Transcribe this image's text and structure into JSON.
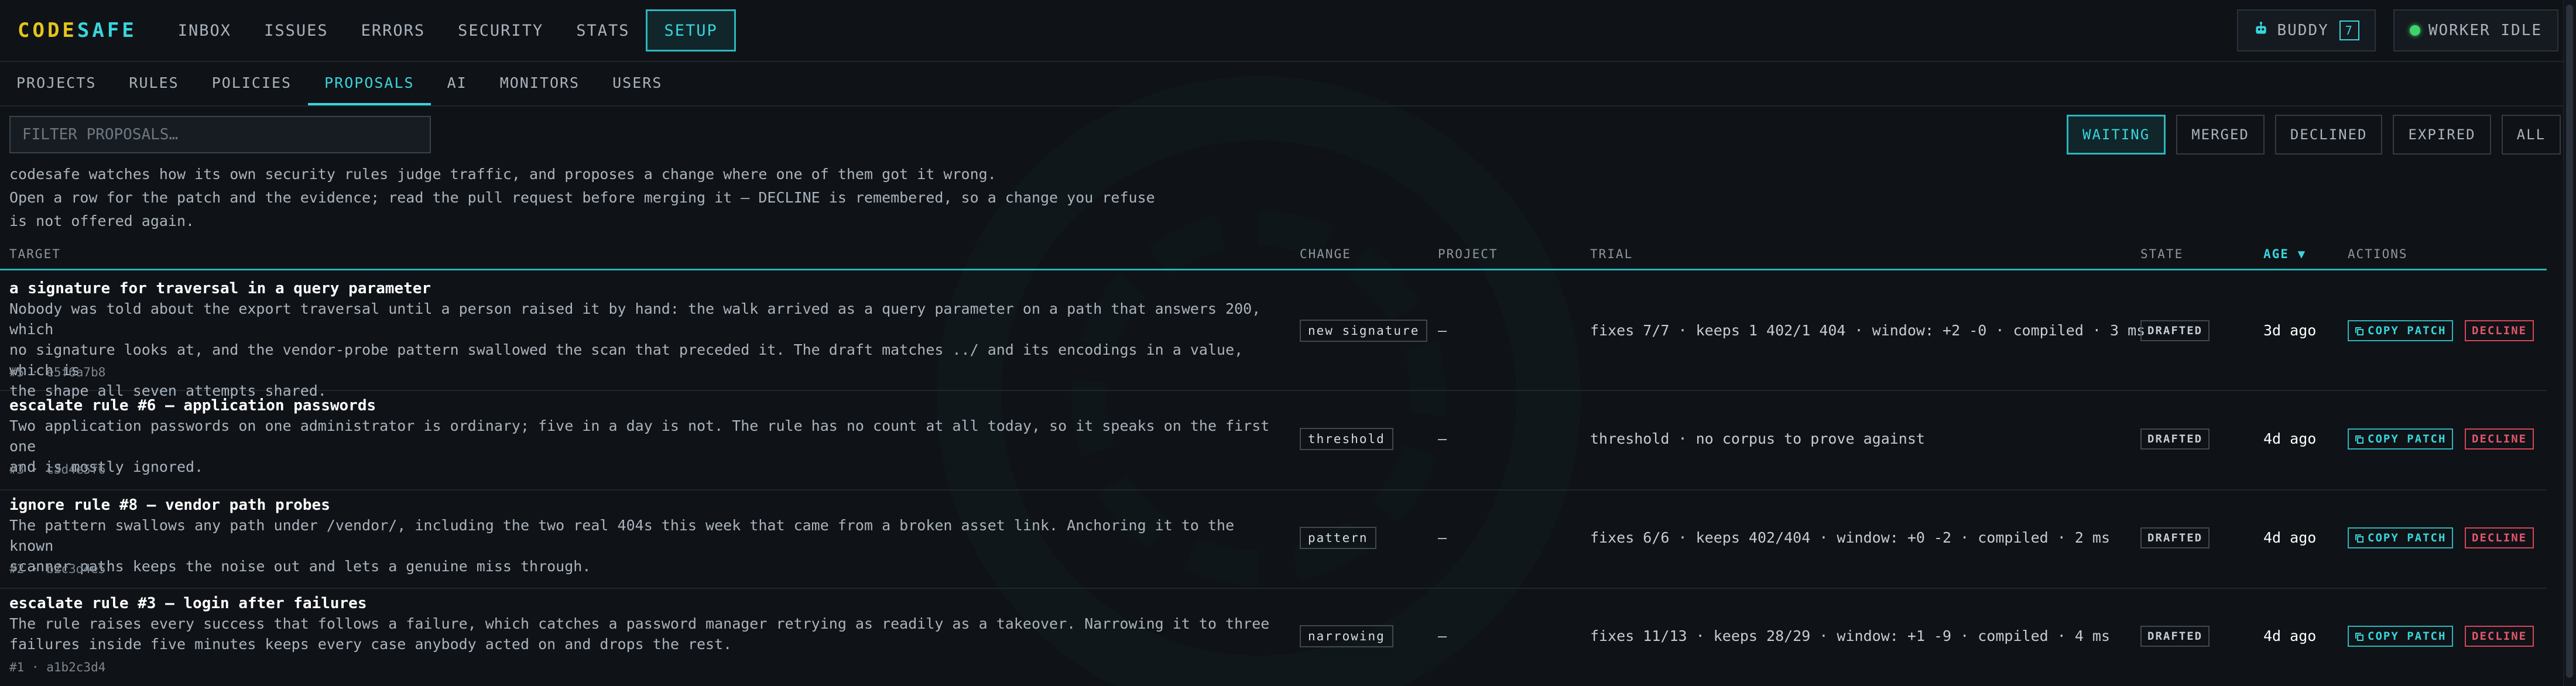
{
  "app": {
    "logo_part1": "CODE",
    "logo_part2": "SAFE"
  },
  "topnav": [
    {
      "label": "INBOX"
    },
    {
      "label": "ISSUES"
    },
    {
      "label": "ERRORS"
    },
    {
      "label": "SECURITY"
    },
    {
      "label": "STATS"
    },
    {
      "label": "SETUP",
      "active": true
    }
  ],
  "buddy": {
    "label": "BUDDY",
    "count": "7",
    "icon": "robot-icon"
  },
  "worker": {
    "label": "WORKER IDLE",
    "status_color": "#3fd36b"
  },
  "subnav": [
    {
      "label": "PROJECTS"
    },
    {
      "label": "RULES"
    },
    {
      "label": "POLICIES"
    },
    {
      "label": "PROPOSALS",
      "active": true
    },
    {
      "label": "AI"
    },
    {
      "label": "MONITORS"
    },
    {
      "label": "USERS"
    }
  ],
  "filter": {
    "placeholder": "FILTER PROPOSALS…",
    "value": ""
  },
  "state_filters": [
    {
      "label": "WAITING",
      "active": true
    },
    {
      "label": "MERGED"
    },
    {
      "label": "DECLINED"
    },
    {
      "label": "EXPIRED"
    },
    {
      "label": "ALL"
    }
  ],
  "intro": {
    "line1": "codesafe watches how its own security rules judge traffic, and proposes a change where one of them got it wrong.",
    "line2": "Open a row for the patch and the evidence; read the pull request before merging it — DECLINE is remembered, so a change you refuse",
    "line3": "is not offered again."
  },
  "columns": {
    "target": "TARGET",
    "change": "CHANGE",
    "project": "PROJECT",
    "trial": "TRIAL",
    "state": "STATE",
    "age": "AGE",
    "age_sort": "▼",
    "actions": "ACTIONS"
  },
  "rows": [
    {
      "title": "a signature for traversal in a query parameter",
      "desc_lines": [
        "Nobody was told about the export traversal until a person raised it by hand: the walk arrived as a query parameter on a path that answers 200, which",
        "no signature looks at, and the vendor-probe pattern swallowed the scan that preceded it. The draft matches ../ and its encodings in a value, which is",
        "the shape all seven attempts shared."
      ],
      "meta": "#5 · e5f6a7b8",
      "change": "new signature",
      "project": "—",
      "trial": "fixes 7/7 · keeps 1 402/1 404 · window: +2 -0 · compiled · 3 ms",
      "state": "DRAFTED",
      "age": "3d ago",
      "copy": "COPY PATCH",
      "decline": "DECLINE"
    },
    {
      "title": "escalate rule #6 — application passwords",
      "desc_lines": [
        "Two application passwords on one administrator is ordinary; five in a day is not. The rule has no count at all today, so it speaks on the first one",
        "and is mostly ignored."
      ],
      "meta": "#3 · c3d4e5f6",
      "change": "threshold",
      "project": "—",
      "trial": "threshold · no corpus to prove against",
      "state": "DRAFTED",
      "age": "4d ago",
      "copy": "COPY PATCH",
      "decline": "DECLINE"
    },
    {
      "title": "ignore rule #8 — vendor path probes",
      "desc_lines": [
        "The pattern swallows any path under /vendor/, including the two real 404s this week that came from a broken asset link. Anchoring it to the known",
        "scanner paths keeps the noise out and lets a genuine miss through."
      ],
      "meta": "#2 · b2c3d4e5",
      "change": "pattern",
      "project": "—",
      "trial": "fixes 6/6 · keeps 402/404 · window: +0 -2 · compiled · 2 ms",
      "state": "DRAFTED",
      "age": "4d ago",
      "copy": "COPY PATCH",
      "decline": "DECLINE"
    },
    {
      "title": "escalate rule #3 — login after failures",
      "desc_lines": [
        "The rule raises every success that follows a failure, which catches a password manager retrying as readily as a takeover. Narrowing it to three",
        "failures inside five minutes keeps every case anybody acted on and drops the rest."
      ],
      "meta": "#1 · a1b2c3d4",
      "change": "narrowing",
      "project": "—",
      "trial": "fixes 11/13 · keeps 28/29 · window: +1 -9 · compiled · 4 ms",
      "state": "DRAFTED",
      "age": "4d ago",
      "copy": "COPY PATCH",
      "decline": "DECLINE"
    }
  ]
}
